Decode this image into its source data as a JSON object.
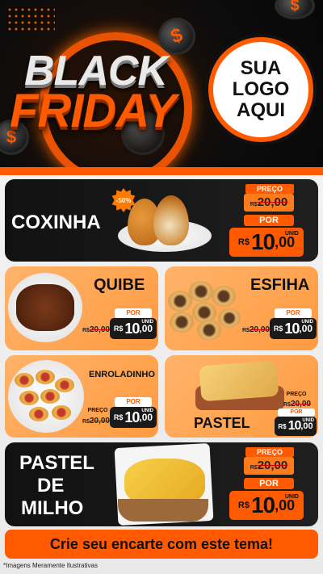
{
  "header": {
    "title_line1": "BLACK",
    "title_line2": "FRIDAY",
    "logo": [
      "SUA",
      "LOGO",
      "AQUI"
    ],
    "coin_symbol": "$"
  },
  "labels": {
    "preco": "PREÇO",
    "por": "POR",
    "currency": "R$",
    "unid": "UNID"
  },
  "products": {
    "coxinha": {
      "name": "COXINHA",
      "old": "20,00",
      "price_int": "10",
      "price_cents": ",00",
      "discount": "-50%"
    },
    "quibe": {
      "name": "QUIBE",
      "old": "20,00",
      "price_int": "10",
      "price_cents": ",00"
    },
    "esfiha": {
      "name": "ESFIHA",
      "old": "20,00",
      "price_int": "10",
      "price_cents": ",00"
    },
    "enroladinho": {
      "name": "ENROLADINHO",
      "old": "20,00",
      "price_int": "10",
      "price_cents": ",00"
    },
    "pastel": {
      "name": "PASTEL",
      "old": "20,00",
      "price_int": "10",
      "price_cents": ",00"
    },
    "pastel_milho": {
      "name_lines": [
        "PASTEL",
        "DE",
        "MILHO"
      ],
      "old": "20,00",
      "price_int": "10",
      "price_cents": ",00"
    }
  },
  "cta": "Crie seu encarte com este tema!",
  "footnote": "*Imagens Meramente Ilustrativas",
  "colors": {
    "accent": "#ff5a00",
    "dark": "#111111",
    "light_card": "#ffa150"
  }
}
